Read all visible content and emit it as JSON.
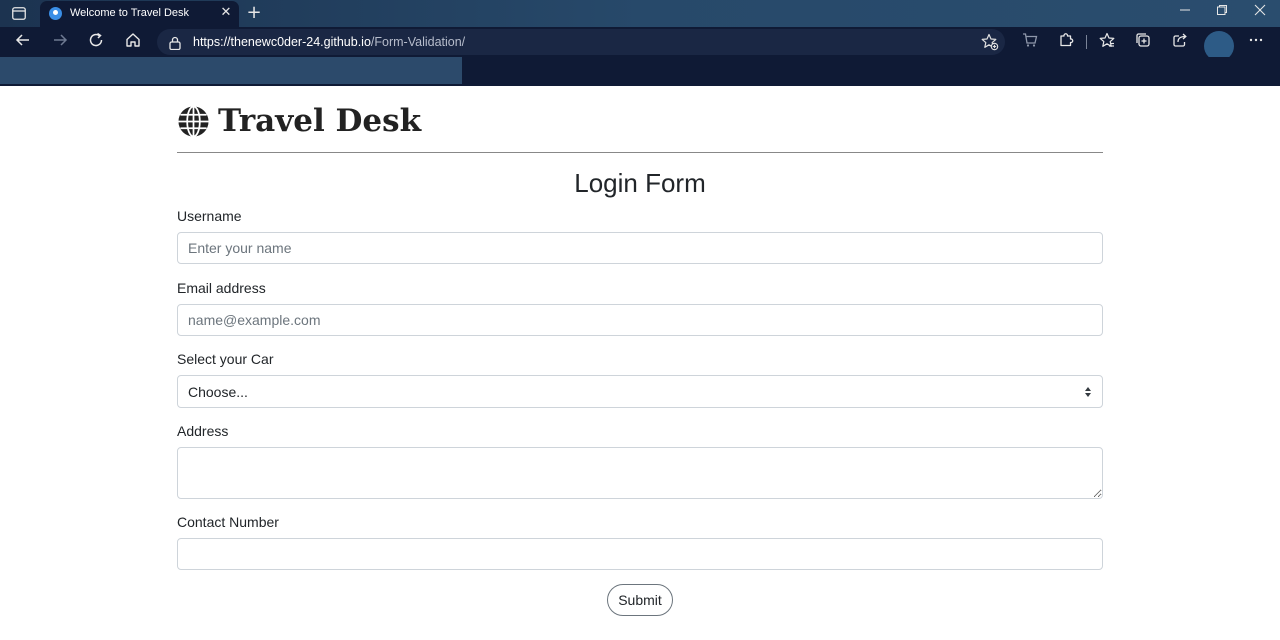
{
  "browser": {
    "tab_title": "Welcome to Travel Desk",
    "close_glyph": "✕",
    "new_tab_glyph": "+",
    "url_host": "https://thenewc0der-24.github.io",
    "url_path": "/Form-Validation/"
  },
  "page": {
    "brand_name": "Travel Desk",
    "form_title": "Login Form",
    "username_label": "Username",
    "username_placeholder": "Enter your name",
    "email_label": "Email address",
    "email_placeholder": "name@example.com",
    "car_label": "Select your Car",
    "car_selected": "Choose...",
    "address_label": "Address",
    "contact_label": "Contact Number",
    "submit_label": "Submit"
  },
  "colors": {
    "tab_bg": "#0f1a35",
    "tabstrip_bg": "#27496a",
    "input_border": "#ced4da",
    "button_border": "#6c757d",
    "text": "#212529"
  }
}
